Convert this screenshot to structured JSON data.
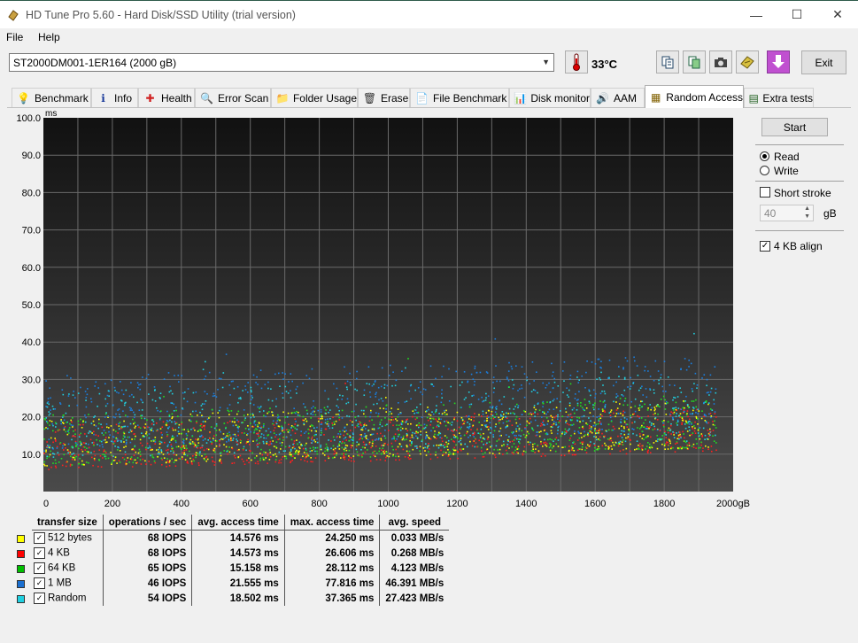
{
  "window": {
    "title": "HD Tune Pro 5.60 - Hard Disk/SSD Utility (trial version)",
    "minimize": "—",
    "maximize": "☐",
    "close": "✕"
  },
  "menu": {
    "file": "File",
    "help": "Help"
  },
  "toolbar": {
    "drive": "ST2000DM001-1ER164 (2000 gB)",
    "temperature": "33°C",
    "exit": "Exit"
  },
  "tabs": [
    {
      "label": "Benchmark",
      "icon": "benchmark-icon"
    },
    {
      "label": "Info",
      "icon": "info-icon"
    },
    {
      "label": "Health",
      "icon": "health-icon"
    },
    {
      "label": "Error Scan",
      "icon": "error-scan-icon"
    },
    {
      "label": "Folder Usage",
      "icon": "folder-icon"
    },
    {
      "label": "Erase",
      "icon": "trash-icon"
    },
    {
      "label": "File Benchmark",
      "icon": "file-benchmark-icon"
    },
    {
      "label": "Disk monitor",
      "icon": "disk-monitor-icon"
    },
    {
      "label": "AAM",
      "icon": "speaker-icon"
    },
    {
      "label": "Random Access",
      "icon": "random-access-icon"
    },
    {
      "label": "Extra tests",
      "icon": "extra-tests-icon"
    }
  ],
  "controls": {
    "start": "Start",
    "read": "Read",
    "write": "Write",
    "short_stroke": "Short stroke",
    "short_stroke_value": "40",
    "short_stroke_unit": "gB",
    "align": "4 KB align",
    "mode": "read",
    "short_stroke_checked": false,
    "align_checked": true
  },
  "chart_data": {
    "type": "scatter",
    "ylabel": "ms",
    "xlabel": "",
    "y_ticks": [
      "10.0",
      "20.0",
      "30.0",
      "40.0",
      "50.0",
      "60.0",
      "70.0",
      "80.0",
      "90.0",
      "100.0"
    ],
    "x_ticks": [
      "0",
      "200",
      "400",
      "600",
      "800",
      "1000",
      "1200",
      "1400",
      "1600",
      "1800",
      "2000gB"
    ],
    "xlim": [
      0,
      2000
    ],
    "ylim": [
      0,
      100
    ],
    "grid": true,
    "series": [
      {
        "name": "512 bytes",
        "color": "#ffff00",
        "access_min_ms": 7,
        "access_spread_ms": 13,
        "end_offset_ms": 5
      },
      {
        "name": "4 KB",
        "color": "#ff2020",
        "access_min_ms": 6,
        "access_spread_ms": 12,
        "end_offset_ms": 5
      },
      {
        "name": "64 KB",
        "color": "#20e020",
        "access_min_ms": 7,
        "access_spread_ms": 14,
        "end_offset_ms": 5
      },
      {
        "name": "1 MB",
        "color": "#1a7fe0",
        "access_min_ms": 11,
        "access_spread_ms": 20,
        "end_offset_ms": 6
      },
      {
        "name": "Random",
        "color": "#20d0e0",
        "access_min_ms": 9,
        "access_spread_ms": 18,
        "end_offset_ms": 5
      }
    ]
  },
  "results": {
    "headers": [
      "transfer size",
      "operations / sec",
      "avg. access time",
      "max. access time",
      "avg. speed"
    ],
    "rows": [
      {
        "size": "512 bytes",
        "color": "#ffff00",
        "ops": "68 IOPS",
        "avg": "14.576 ms",
        "max": "24.250 ms",
        "speed": "0.033 MB/s"
      },
      {
        "size": "4 KB",
        "color": "#ff0000",
        "ops": "68 IOPS",
        "avg": "14.573 ms",
        "max": "26.606 ms",
        "speed": "0.268 MB/s"
      },
      {
        "size": "64 KB",
        "color": "#00c000",
        "ops": "65 IOPS",
        "avg": "15.158 ms",
        "max": "28.112 ms",
        "speed": "4.123 MB/s"
      },
      {
        "size": "1 MB",
        "color": "#1a6fd0",
        "ops": "46 IOPS",
        "avg": "21.555 ms",
        "max": "77.816 ms",
        "speed": "46.391 MB/s"
      },
      {
        "size": "Random",
        "color": "#20d0e0",
        "ops": "54 IOPS",
        "avg": "18.502 ms",
        "max": "37.365 ms",
        "speed": "27.423 MB/s"
      }
    ]
  }
}
